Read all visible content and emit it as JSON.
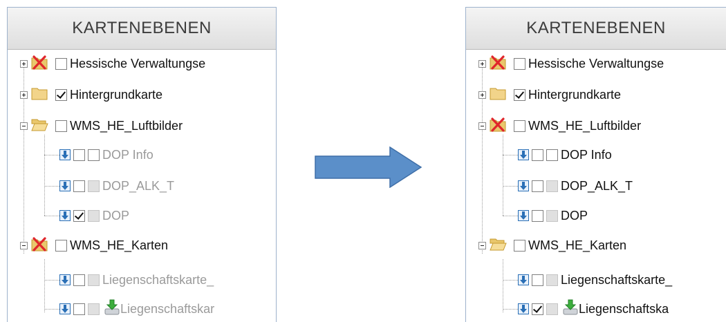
{
  "header_title": "KARTENEBENEN",
  "left": {
    "rows": [
      {
        "label": "Hessische Verwaltungse",
        "checked": false,
        "icon": "error-x-icon"
      },
      {
        "label": "Hintergrundkarte",
        "checked": true,
        "icon": "folder-closed-icon"
      },
      {
        "label": "WMS_HE_Luftbilder",
        "checked": false,
        "icon": "folder-open-icon"
      },
      {
        "label": "DOP Info",
        "checked": false
      },
      {
        "label": "DOP_ALK_T",
        "checked": false
      },
      {
        "label": "DOP",
        "checked": true
      },
      {
        "label": "WMS_HE_Karten",
        "checked": false,
        "icon": "error-x-icon"
      },
      {
        "label": "Liegenschaftskarte_",
        "checked": false
      },
      {
        "label": "Liegenschaftskar",
        "checked": false,
        "icon": "download-drive-icon"
      }
    ]
  },
  "right": {
    "rows": [
      {
        "label": "Hessische Verwaltungse",
        "checked": false,
        "icon": "error-x-icon"
      },
      {
        "label": "Hintergrundkarte",
        "checked": true,
        "icon": "folder-closed-icon"
      },
      {
        "label": "WMS_HE_Luftbilder",
        "checked": false,
        "icon": "error-x-icon"
      },
      {
        "label": "DOP Info",
        "checked": false
      },
      {
        "label": "DOP_ALK_T",
        "checked": false
      },
      {
        "label": "DOP",
        "checked": false
      },
      {
        "label": "WMS_HE_Karten",
        "checked": false,
        "icon": "folder-open-icon"
      },
      {
        "label": "Liegenschaftskarte_",
        "checked": false
      },
      {
        "label": "Liegenschaftska",
        "checked": true,
        "icon": "download-drive-icon"
      }
    ]
  },
  "colors": {
    "arrow": "#5b8fc9",
    "panel_border": "#9db2cc",
    "info_icon": "#2a6fb6",
    "error_x": "#e0262b"
  }
}
